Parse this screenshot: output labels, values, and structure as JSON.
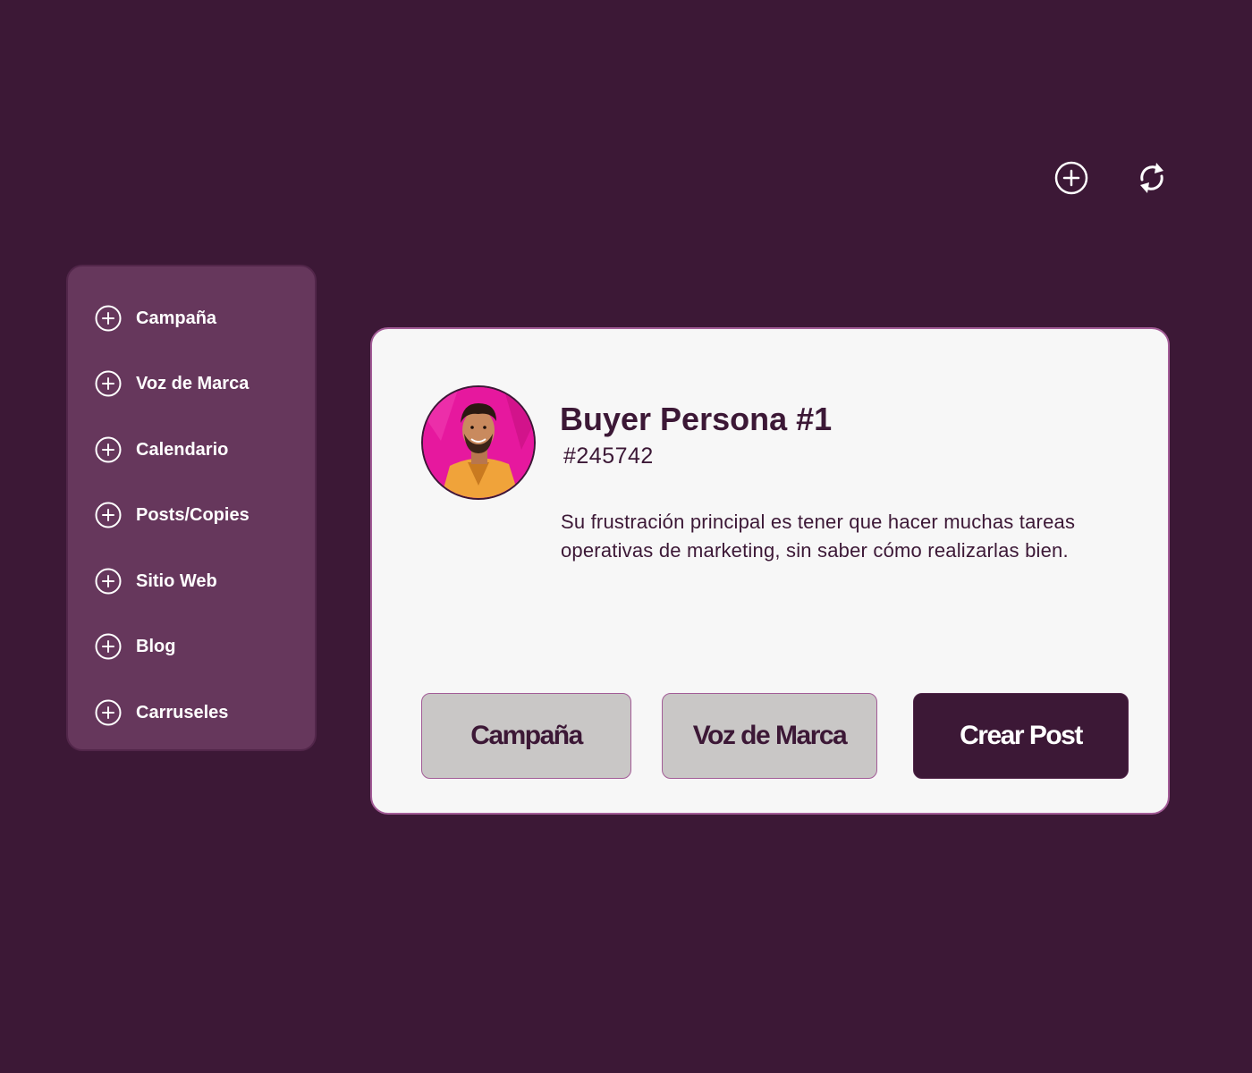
{
  "toolbar": {
    "add_icon": "plus-circle-icon",
    "refresh_icon": "refresh-icon"
  },
  "sidebar": {
    "item_icon": "plus-circle-icon",
    "items": [
      {
        "label": "Campaña"
      },
      {
        "label": "Voz de Marca"
      },
      {
        "label": "Calendario"
      },
      {
        "label": "Posts/Copies"
      },
      {
        "label": "Sitio Web"
      },
      {
        "label": "Blog"
      },
      {
        "label": "Carruseles"
      }
    ]
  },
  "card": {
    "avatar_icon": "person-photo",
    "title": "Buyer Persona #1",
    "id": "#245742",
    "description": "Su frustración principal es tener que hacer muchas tareas operativas de marketing, sin saber cómo realizarlas bien.",
    "buttons": {
      "campaign": "Campaña",
      "brand_voice": "Voz de Marca",
      "create_post": "Crear Post"
    }
  },
  "colors": {
    "background": "#3c1836",
    "sidebar": "#66375c",
    "card": "#f7f7f7",
    "accent_border": "#a35c97",
    "button_secondary": "#c9c7c6",
    "avatar_bg": "#e6189e"
  }
}
